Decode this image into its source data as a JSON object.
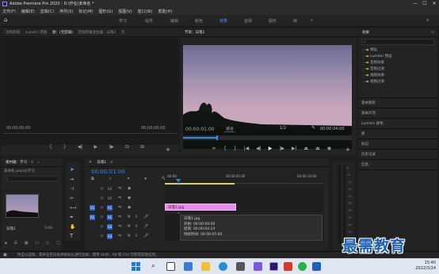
{
  "titlebar": {
    "title": "Adobe Premiere Pro 2020 - D:\\作业\\未命名 *",
    "min": "—",
    "max": "☐",
    "close": "✕"
  },
  "menu": [
    "文件(F)",
    "编辑(E)",
    "剪辑(C)",
    "序列(S)",
    "标记(M)",
    "图形(G)",
    "视图(V)",
    "窗口(W)",
    "帮助(H)"
  ],
  "workspaces": [
    "学习",
    "组件",
    "编辑",
    "颜色",
    "效果",
    "音频",
    "图形",
    "库"
  ],
  "source_panel": {
    "tabs": [
      "音频剪辑",
      "Lumetri 范围",
      "源：(无剪辑)",
      "音频剪辑混合器：日落1",
      "元"
    ],
    "timecode": "00;00;00;00",
    "timecode_right": "00;00;00;00"
  },
  "program_panel": {
    "tab": "节目：日落1",
    "timecode": "00:00:01:00",
    "fit": "适合",
    "quality": "1/2",
    "duration": "00:00:04:00"
  },
  "effects_panel": {
    "tab": "效果",
    "search_placeholder": "",
    "items": [
      "预设",
      "Lumetri 预设",
      "音频效果",
      "音频过渡",
      "视频效果",
      "视频过渡"
    ],
    "sections": [
      "基本图形",
      "基本声音",
      "Lumetri 颜色",
      "库",
      "标记",
      "历史记录",
      "信息"
    ]
  },
  "project_panel": {
    "tab": "素材箱：学习",
    "path": "未命名.prproj\\学习",
    "clip_name": "日落1",
    "clip_duration": "5:00"
  },
  "timeline": {
    "tab": "日落1",
    "timecode": "00:00:01:00",
    "ruler": [
      ":00:00",
      "00:00:05:00",
      "00:00:10:00"
    ],
    "video_tracks": [
      "V3",
      "V2",
      "V1"
    ],
    "audio_tracks": [
      "A1",
      "A2",
      "A3"
    ],
    "clip_label": "日落1.jpg",
    "tooltip": {
      "name": "日落1.jpg",
      "start": "开始: 00:00:00:00",
      "end": "结束: 00:00:04:24",
      "duration": "持续时间: 00:00:05:00"
    }
  },
  "statusbar": "单击以选择，或单击空白处并拖动以进行选择。使用 Shift、Alt 和 Ctrl 可获得其他选项。",
  "watermark": "最需教育",
  "taskbar": {
    "time": "15:40",
    "date": "2022/3/24"
  },
  "colors": {
    "accent": "#2d8ceb",
    "clip": "#e58ee8",
    "bg": "#1d1d1d"
  }
}
